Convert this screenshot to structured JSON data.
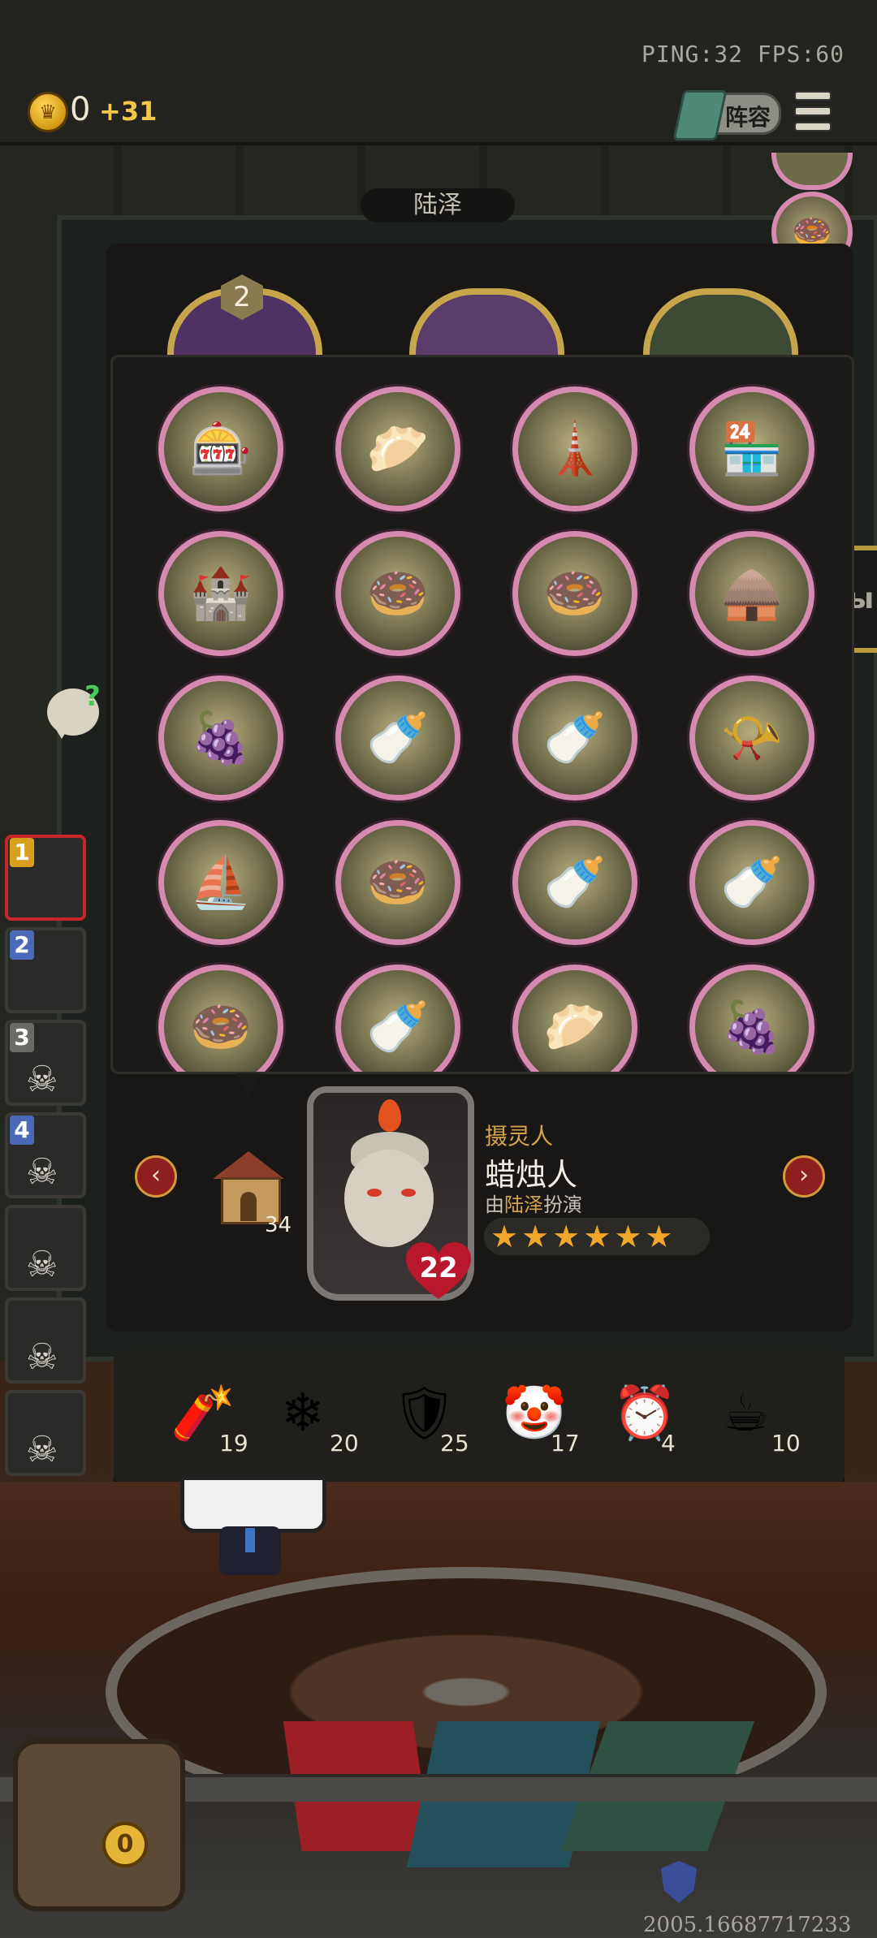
{
  "status": {
    "ping_fps": "PING:32   FPS:60"
  },
  "currency": {
    "amount": "0",
    "income": "+31",
    "coin_symbol": "♛"
  },
  "header": {
    "lineup_label": "阵容"
  },
  "panel": {
    "player_name": "陆泽",
    "round_badge": "2"
  },
  "side_button": {
    "text": "ы"
  },
  "items": [
    {
      "name": "gacha-machine-icon",
      "glyph": "🎰"
    },
    {
      "name": "golden-pastry-icon",
      "glyph": "🥟"
    },
    {
      "name": "lighthouse-icon",
      "glyph": "🗼"
    },
    {
      "name": "market-stall-icon",
      "glyph": "🏪"
    },
    {
      "name": "castle-icon",
      "glyph": "🏰"
    },
    {
      "name": "donut-cannon-icon",
      "glyph": "🍩"
    },
    {
      "name": "donut-cannon-icon",
      "glyph": "🍩"
    },
    {
      "name": "grain-barn-icon",
      "glyph": "🛖"
    },
    {
      "name": "grape-syringe-icon",
      "glyph": "🍇"
    },
    {
      "name": "milk-bottle-house-icon",
      "glyph": "🍼"
    },
    {
      "name": "milk-bottle-house-icon",
      "glyph": "🍼"
    },
    {
      "name": "pink-gramophone-icon",
      "glyph": "📯"
    },
    {
      "name": "sailing-ship-icon",
      "glyph": "⛵"
    },
    {
      "name": "donut-cannon-icon",
      "glyph": "🍩"
    },
    {
      "name": "milk-bottle-house-icon",
      "glyph": "🍼"
    },
    {
      "name": "milk-bottle-house-icon",
      "glyph": "🍼"
    },
    {
      "name": "donut-cannon-icon",
      "glyph": "🍩"
    },
    {
      "name": "milk-bottle-house-icon",
      "glyph": "🍼"
    },
    {
      "name": "golden-pastry-icon",
      "glyph": "🥟"
    },
    {
      "name": "grape-syringe-icon",
      "glyph": "🍇"
    }
  ],
  "character": {
    "role": "摄灵人",
    "name": "蜡烛人",
    "actor_prefix": "由",
    "actor_name": "陆泽",
    "actor_suffix": "扮演",
    "health": "22",
    "house_count": "34",
    "stars": [
      "★",
      "★",
      "★",
      "★",
      "★",
      "★"
    ]
  },
  "inventory": [
    {
      "name": "firecracker-icon",
      "glyph": "🧨",
      "count": "19"
    },
    {
      "name": "snowflake-icon",
      "glyph": "❄",
      "count": "20"
    },
    {
      "name": "mirror-shield-icon",
      "glyph": "🛡",
      "count": "25"
    },
    {
      "name": "clown-icon",
      "glyph": "🤡",
      "count": "17"
    },
    {
      "name": "alarm-clock-icon",
      "glyph": "⏰",
      "count": "4"
    },
    {
      "name": "teacup-icon",
      "glyph": "☕",
      "count": "10"
    }
  ],
  "players": [
    {
      "num": "1",
      "color": "#d8a01c"
    },
    {
      "num": "2",
      "color": "#4a6ab8"
    },
    {
      "num": "3",
      "color": "#6a6a66"
    },
    {
      "num": "4",
      "color": "#4a6ab8"
    },
    {
      "num": "",
      "color": "#6a6a66"
    },
    {
      "num": "",
      "color": "#6a6a66"
    },
    {
      "num": "",
      "color": "#6a6a66"
    },
    {
      "num": "",
      "color": "#6a6a66"
    }
  ],
  "chest": {
    "count": "0"
  },
  "footer": {
    "version": "2005.16687717233"
  },
  "glyphs": {
    "prev": "‹",
    "next": "›",
    "skull": "☠",
    "chat_q": "?"
  }
}
